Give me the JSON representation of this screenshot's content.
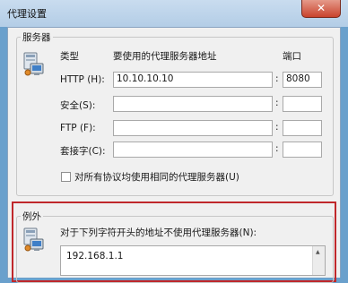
{
  "window": {
    "title": "代理设置",
    "close_glyph": "✕"
  },
  "servers": {
    "legend": "服务器",
    "header_type": "类型",
    "header_address": "要使用的代理服务器地址",
    "header_port": "端口",
    "rows": [
      {
        "label": "HTTP (H):",
        "address": "10.10.10.10",
        "port": "8080"
      },
      {
        "label": "安全(S):",
        "address": "",
        "port": ""
      },
      {
        "label": "FTP (F):",
        "address": "",
        "port": ""
      },
      {
        "label": "套接字(C):",
        "address": "",
        "port": ""
      }
    ],
    "colon": ":",
    "same_proxy_label": "对所有协议均使用相同的代理服务器(U)",
    "same_proxy_checked": false
  },
  "exceptions": {
    "legend": "例外",
    "description": "对于下列字符开头的地址不使用代理服务器(N):",
    "value": "192.168.1.1"
  },
  "icons": {
    "server": "network-computer-icon",
    "exceptions": "network-computer-icon"
  },
  "colors": {
    "highlight_frame": "#c0282b",
    "title_bar": "#b3cde6"
  }
}
